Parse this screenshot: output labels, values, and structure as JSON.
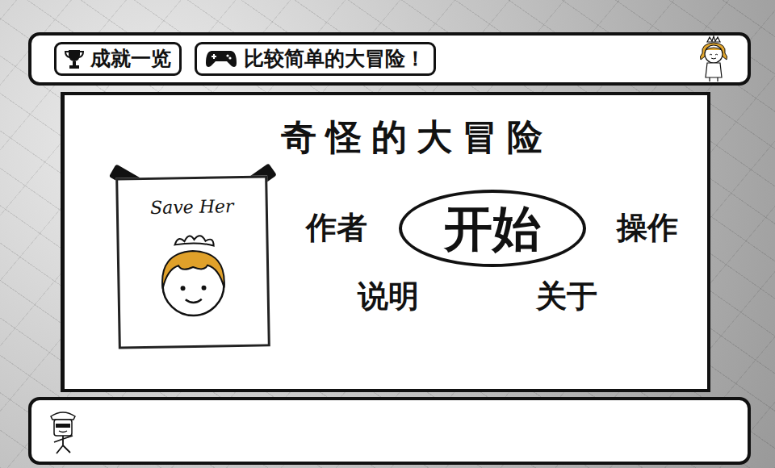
{
  "top_buttons": [
    {
      "label": "成就一览"
    },
    {
      "label": "比较简单的大冒险！"
    }
  ],
  "title": "奇怪的大冒险",
  "poster": {
    "caption": "Save Her"
  },
  "menu": [
    {
      "label": "作者",
      "selected": false
    },
    {
      "label": "开始",
      "selected": true
    },
    {
      "label": "操作",
      "selected": false
    },
    {
      "label": "说明",
      "selected": false
    },
    {
      "label": "关于",
      "selected": false
    }
  ]
}
